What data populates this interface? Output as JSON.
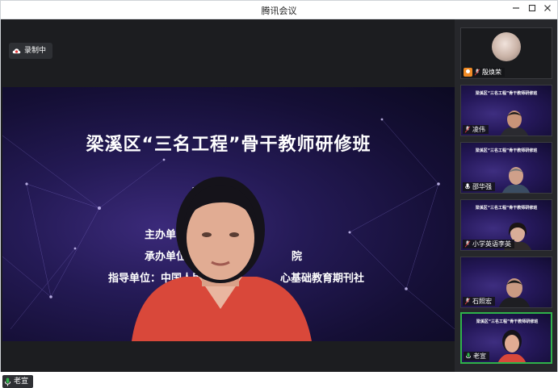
{
  "window": {
    "title": "腾讯会议"
  },
  "titlebar": {
    "minimize_icon": "minimize-icon",
    "maximize_icon": "maximize-icon",
    "close_icon": "close-icon"
  },
  "recording": {
    "label": "录制中",
    "icon": "cloud-record-icon"
  },
  "shared_screen": {
    "slide_title": "梁溪区“三名工程”骨干教师研修班",
    "slide_subtitle": "开",
    "line1": "主办单位：",
    "line2": "承办单位：",
    "line2_tail": "院",
    "line3": "指导单位：中国人民",
    "line3_tail": "心基础教育期刊社"
  },
  "speaker": {
    "name": "老宣",
    "mic_icon": "mic-icon"
  },
  "participants": [
    {
      "name": "殷焕荣",
      "type": "avatar"
    },
    {
      "name": "凌伟",
      "type": "video",
      "slide_title": "梁溪区“三名工程”骨干教师研修班"
    },
    {
      "name": "邵华强",
      "type": "video",
      "slide_title": "梁溪区“三名工程”骨干教师研修班"
    },
    {
      "name": "小学英语李英",
      "type": "video",
      "slide_title": "梁溪区“三名工程”骨干教师研修班"
    },
    {
      "name": "石照宏",
      "type": "video",
      "slide_title": "梁溪区“三名工程”骨干教师研修班"
    },
    {
      "name": "老宣",
      "type": "video",
      "active": true,
      "slide_title": "梁溪区“三名工程”骨干教师研修班"
    }
  ],
  "colors": {
    "accent_green": "#2fb24a",
    "host_orange": "#f08a24",
    "recording_red": "#e23b3b"
  }
}
